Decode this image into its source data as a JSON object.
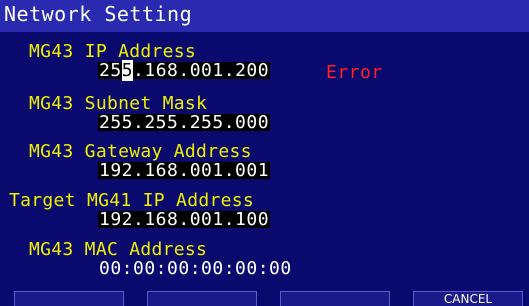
{
  "title": "Network Setting",
  "fields": [
    {
      "label": "MG43 IP Address",
      "value_before_cursor": "25",
      "cursor_char": "5",
      "value_after_cursor": ".168.001.200",
      "error": "Error"
    },
    {
      "label": "MG43 Subnet Mask",
      "value": "255.255.255.000"
    },
    {
      "label": "MG43 Gateway Address",
      "value": "192.168.001.001"
    },
    {
      "label": "Target MG41 IP Address",
      "value": "192.168.001.100"
    },
    {
      "label": "MG43 MAC Address",
      "value": "00:00:00:00:00:00"
    }
  ],
  "softkeys": [
    "",
    "",
    "",
    "CANCEL"
  ],
  "colors": {
    "background": "#0a0a6e",
    "titlebar": "#2a2ab0",
    "label": "#f0f000",
    "value": "#ffffff",
    "error": "#ff2020"
  }
}
